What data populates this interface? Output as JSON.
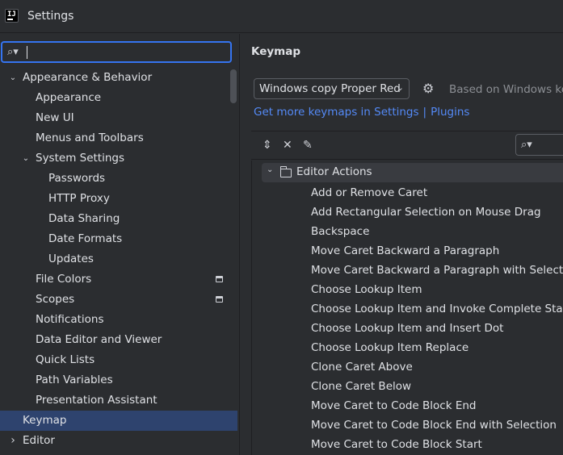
{
  "window": {
    "title": "Settings",
    "app_icon_text": "IJ"
  },
  "search": {
    "value": "",
    "placeholder": ""
  },
  "tree": [
    {
      "label": "Appearance & Behavior",
      "level": 0,
      "chevron": "down"
    },
    {
      "label": "Appearance",
      "level": 1
    },
    {
      "label": "New UI",
      "level": 1
    },
    {
      "label": "Menus and Toolbars",
      "level": 1
    },
    {
      "label": "System Settings",
      "level": 1,
      "chevron": "down"
    },
    {
      "label": "Passwords",
      "level": 2
    },
    {
      "label": "HTTP Proxy",
      "level": 2
    },
    {
      "label": "Data Sharing",
      "level": 2
    },
    {
      "label": "Date Formats",
      "level": 2
    },
    {
      "label": "Updates",
      "level": 2
    },
    {
      "label": "File Colors",
      "level": 1,
      "project_icon": true
    },
    {
      "label": "Scopes",
      "level": 1,
      "project_icon": true
    },
    {
      "label": "Notifications",
      "level": 1
    },
    {
      "label": "Data Editor and Viewer",
      "level": 1
    },
    {
      "label": "Quick Lists",
      "level": 1
    },
    {
      "label": "Path Variables",
      "level": 1
    },
    {
      "label": "Presentation Assistant",
      "level": 1
    },
    {
      "label": "Keymap",
      "level": 0,
      "selected": true
    },
    {
      "label": "Editor",
      "level": 0,
      "chevron": "right"
    }
  ],
  "keymap": {
    "title": "Keymap",
    "selected_keymap": "Windows copy Proper Red",
    "based_on": "Based on Windows key",
    "more_link_text": "Get more keymaps in Settings",
    "link_separator": "|",
    "plugins_link": "Plugins",
    "filter": {
      "value": "",
      "placeholder": ""
    },
    "group_label": "Editor Actions",
    "actions": [
      "Add or Remove Caret",
      "Add Rectangular Selection on Mouse Drag",
      "Backspace",
      "Move Caret Backward a Paragraph",
      "Move Caret Backward a Paragraph with Selection",
      "Choose Lookup Item",
      "Choose Lookup Item and Invoke Complete Statement",
      "Choose Lookup Item and Insert Dot",
      "Choose Lookup Item Replace",
      "Clone Caret Above",
      "Clone Caret Below",
      "Move Caret to Code Block End",
      "Move Caret to Code Block End with Selection",
      "Move Caret to Code Block Start"
    ]
  },
  "colors": {
    "background": "#2b2d30",
    "selection": "#2e436e",
    "focus_border": "#3574f0",
    "link": "#548af7"
  }
}
